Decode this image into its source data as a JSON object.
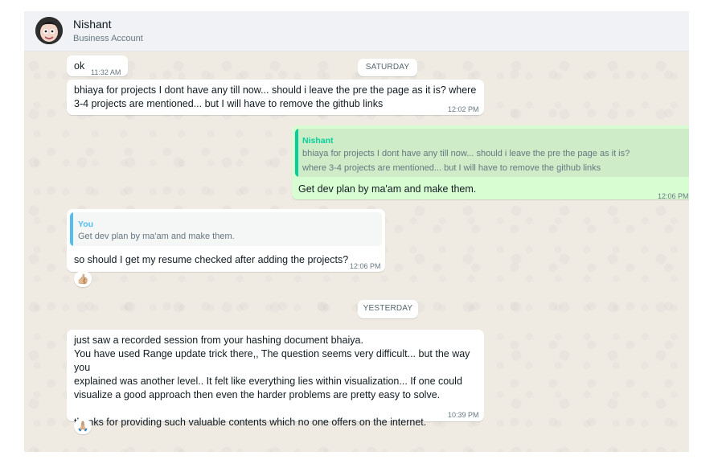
{
  "header": {
    "contact_name": "Nishant",
    "contact_subtitle": "Business Account"
  },
  "messages": [
    {
      "text": "ok",
      "time": "11:32 AM"
    },
    {
      "text": "bhiaya for projects I dont have any till now... should i leave the pre the page as it is? where\n3-4 projects are mentioned... but I will have to remove the github links",
      "time": "12:02 PM"
    },
    {
      "quote": {
        "name": "Nishant",
        "text": "bhiaya for projects I dont have any till now... should i leave the pre the page as it is?\nwhere 3-4 projects are mentioned... but I will have to remove the github links"
      },
      "text": "Get dev plan by ma'am and make them.",
      "time": "12:06 PM"
    },
    {
      "quote": {
        "name": "You",
        "text": "Get dev plan by ma'am and make them."
      },
      "text": "so should I get my resume checked after adding the projects?",
      "time": "12:06 PM",
      "reaction": "👍🏼"
    },
    {
      "text": "just saw a recorded session from your hashing document bhaiya.\nYou have used Range update trick there,, The question seems very difficult... but the way you\nexplained was another level.. It felt like everything lies within visualization... If one could\nvisualize a good approach then even the harder problems are pretty easy to solve.\n\nthanks for providing such valuable contents which no one offers on the internet.",
      "time": "10:39 PM",
      "reaction": "🙏🏼"
    }
  ],
  "date_chips": {
    "saturday": "SATURDAY",
    "yesterday": "YESTERDAY"
  },
  "colors": {
    "chat_background": "#efeae2",
    "outgoing_bubble": "#d9fdd3",
    "incoming_bubble": "#ffffff",
    "quote_out_bar": "#06cf9c",
    "quote_out_name": "#06cf9c",
    "quote_in_bar": "#53bdeb",
    "quote_in_name": "#53bdeb"
  }
}
